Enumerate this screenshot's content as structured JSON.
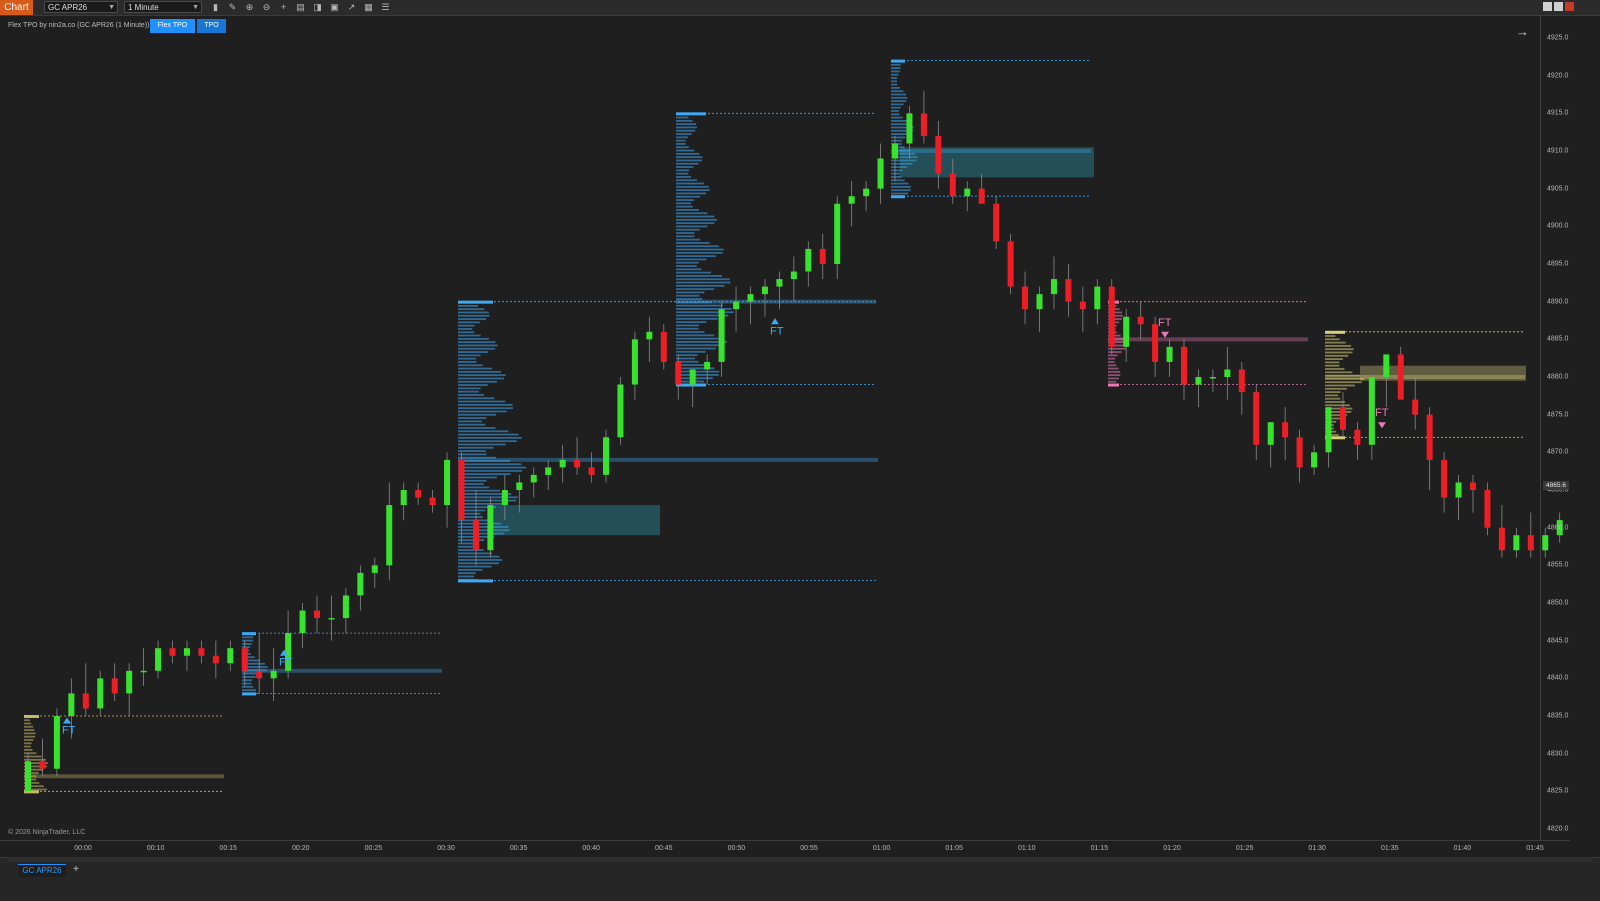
{
  "toolbar": {
    "chart_label": "Chart",
    "instrument": "GC APR26",
    "timeframe": "1 Minute"
  },
  "indicator": {
    "label": "Flex TPO by nin2a.co (GC APR26 (1 Minute))",
    "tabs": [
      "Flex TPO",
      "TPO"
    ]
  },
  "copyright": "© 2026 NinjaTrader, LLC",
  "bottom_tab": "GC APR26",
  "price_tag": "4865.6",
  "chart_data": {
    "type": "candlestick",
    "y_ticks": [
      "4925.0",
      "4920.0",
      "4915.0",
      "4910.0",
      "4905.0",
      "4900.0",
      "4895.0",
      "4890.0",
      "4885.0",
      "4880.0",
      "4875.0",
      "4870.0",
      "4865.0",
      "4860.0",
      "4855.0",
      "4850.0",
      "4845.0",
      "4840.0",
      "4835.0",
      "4830.0",
      "4825.0",
      "4820.0"
    ],
    "x_ticks": [
      "00:00",
      "00:10",
      "00:15",
      "00:20",
      "00:25",
      "00:30",
      "00:35",
      "00:40",
      "00:45",
      "00:50",
      "00:55",
      "01:00",
      "01:05",
      "01:10",
      "01:15",
      "01:20",
      "01:25",
      "01:30",
      "01:35",
      "01:40",
      "01:45"
    ],
    "ylim": [
      4820,
      4925
    ],
    "signal_label": "FT",
    "candles": [
      [
        4825,
        4830,
        4826,
        4829
      ],
      [
        4829,
        4832,
        4827,
        4828
      ],
      [
        4828,
        4836,
        4827,
        4835
      ],
      [
        4835,
        4840,
        4832,
        4838
      ],
      [
        4838,
        4842,
        4835,
        4836
      ],
      [
        4836,
        4841,
        4835,
        4840
      ],
      [
        4840,
        4842,
        4837,
        4838
      ],
      [
        4838,
        4842,
        4835,
        4841
      ],
      [
        4841,
        4844,
        4839,
        4841
      ],
      [
        4841,
        4845,
        4840,
        4844
      ],
      [
        4844,
        4845,
        4842,
        4843
      ],
      [
        4843,
        4845,
        4841,
        4844
      ],
      [
        4844,
        4845,
        4842,
        4843
      ],
      [
        4843,
        4845,
        4840,
        4842
      ],
      [
        4842,
        4845,
        4841,
        4844
      ],
      [
        4844,
        4845,
        4839,
        4841
      ],
      [
        4841,
        4846,
        4838,
        4840
      ],
      [
        4840,
        4844,
        4837,
        4841
      ],
      [
        4841,
        4849,
        4840,
        4846
      ],
      [
        4846,
        4850,
        4844,
        4849
      ],
      [
        4849,
        4851,
        4846,
        4848
      ],
      [
        4848,
        4851,
        4845,
        4848
      ],
      [
        4848,
        4852,
        4846,
        4851
      ],
      [
        4851,
        4855,
        4849,
        4854
      ],
      [
        4854,
        4856,
        4852,
        4855
      ],
      [
        4855,
        4866,
        4853,
        4863
      ],
      [
        4863,
        4866,
        4861,
        4865
      ],
      [
        4865,
        4866,
        4863,
        4864
      ],
      [
        4864,
        4865,
        4862,
        4863
      ],
      [
        4863,
        4870,
        4860,
        4869
      ],
      [
        4869,
        4870,
        4858,
        4861
      ],
      [
        4861,
        4865,
        4855,
        4857
      ],
      [
        4857,
        4864,
        4856,
        4863
      ],
      [
        4863,
        4867,
        4861,
        4865
      ],
      [
        4865,
        4867,
        4862,
        4866
      ],
      [
        4866,
        4868,
        4864,
        4867
      ],
      [
        4867,
        4869,
        4865,
        4868
      ],
      [
        4868,
        4871,
        4866,
        4869
      ],
      [
        4869,
        4872,
        4867,
        4868
      ],
      [
        4868,
        4870,
        4866,
        4867
      ],
      [
        4867,
        4873,
        4866,
        4872
      ],
      [
        4872,
        4880,
        4871,
        4879
      ],
      [
        4879,
        4886,
        4877,
        4885
      ],
      [
        4885,
        4888,
        4882,
        4886
      ],
      [
        4886,
        4887,
        4881,
        4882
      ],
      [
        4882,
        4883,
        4877,
        4879
      ],
      [
        4879,
        4881,
        4876,
        4881
      ],
      [
        4881,
        4883,
        4879,
        4882
      ],
      [
        4882,
        4890,
        4880,
        4889
      ],
      [
        4889,
        4892,
        4886,
        4890
      ],
      [
        4890,
        4892,
        4887,
        4891
      ],
      [
        4891,
        4893,
        4888,
        4892
      ],
      [
        4892,
        4894,
        4889,
        4893
      ],
      [
        4893,
        4896,
        4890,
        4894
      ],
      [
        4894,
        4898,
        4892,
        4897
      ],
      [
        4897,
        4899,
        4893,
        4895
      ],
      [
        4895,
        4904,
        4893,
        4903
      ],
      [
        4903,
        4906,
        4900,
        4904
      ],
      [
        4904,
        4906,
        4902,
        4905
      ],
      [
        4905,
        4911,
        4903,
        4909
      ],
      [
        4909,
        4912,
        4906,
        4911
      ],
      [
        4911,
        4916,
        4909,
        4915
      ],
      [
        4915,
        4918,
        4911,
        4912
      ],
      [
        4912,
        4914,
        4905,
        4907
      ],
      [
        4907,
        4909,
        4903,
        4904
      ],
      [
        4904,
        4906,
        4902,
        4905
      ],
      [
        4905,
        4907,
        4903,
        4903
      ],
      [
        4903,
        4904,
        4897,
        4898
      ],
      [
        4898,
        4899,
        4891,
        4892
      ],
      [
        4892,
        4894,
        4887,
        4889
      ],
      [
        4889,
        4892,
        4886,
        4891
      ],
      [
        4891,
        4896,
        4889,
        4893
      ],
      [
        4893,
        4895,
        4888,
        4890
      ],
      [
        4890,
        4892,
        4886,
        4889
      ],
      [
        4889,
        4893,
        4887,
        4892
      ],
      [
        4892,
        4893,
        4883,
        4884
      ],
      [
        4884,
        4889,
        4882,
        4888
      ],
      [
        4888,
        4890,
        4885,
        4887
      ],
      [
        4887,
        4888,
        4880,
        4882
      ],
      [
        4882,
        4885,
        4880,
        4884
      ],
      [
        4884,
        4885,
        4877,
        4879
      ],
      [
        4879,
        4881,
        4876,
        4880
      ],
      [
        4880,
        4881,
        4878,
        4880
      ],
      [
        4880,
        4884,
        4877,
        4881
      ],
      [
        4881,
        4882,
        4875,
        4878
      ],
      [
        4878,
        4879,
        4869,
        4871
      ],
      [
        4871,
        4874,
        4868,
        4874
      ],
      [
        4874,
        4876,
        4869,
        4872
      ],
      [
        4872,
        4873,
        4866,
        4868
      ],
      [
        4868,
        4871,
        4867,
        4870
      ],
      [
        4870,
        4875,
        4868,
        4876
      ],
      [
        4876,
        4878,
        4872,
        4873
      ],
      [
        4873,
        4874,
        4869,
        4871
      ],
      [
        4871,
        4880,
        4869,
        4880
      ],
      [
        4880,
        4882,
        4876,
        4883
      ],
      [
        4883,
        4884,
        4878,
        4877
      ],
      [
        4877,
        4880,
        4873,
        4875
      ],
      [
        4875,
        4876,
        4865,
        4869
      ],
      [
        4869,
        4870,
        4862,
        4864
      ],
      [
        4864,
        4867,
        4861,
        4866
      ],
      [
        4866,
        4867,
        4862,
        4865
      ],
      [
        4865,
        4866,
        4859,
        4860
      ],
      [
        4860,
        4863,
        4856,
        4857
      ],
      [
        4857,
        4860,
        4856,
        4859
      ],
      [
        4859,
        4862,
        4856,
        4857
      ],
      [
        4857,
        4860,
        4856,
        4859
      ],
      [
        4859,
        4862,
        4858,
        4861
      ],
      [
        4861,
        4866,
        4860,
        4865
      ]
    ]
  }
}
